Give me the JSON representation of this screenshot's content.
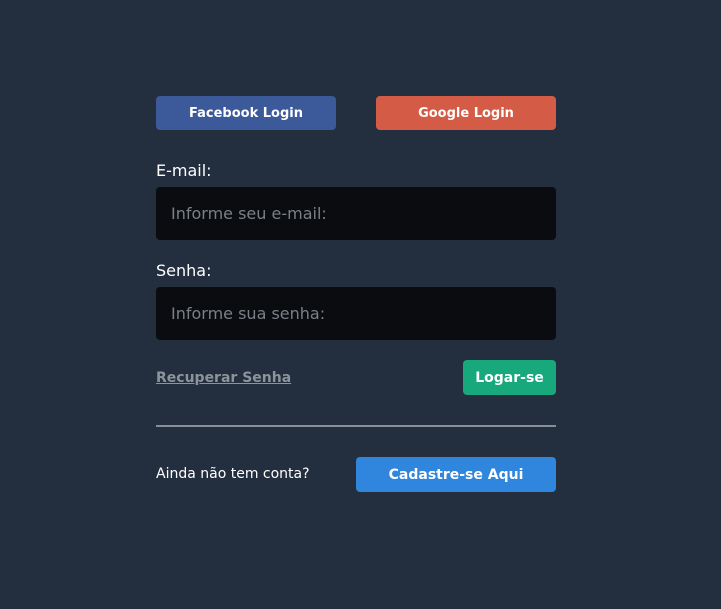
{
  "social": {
    "facebook_label": "Facebook Login",
    "google_label": "Google Login"
  },
  "form": {
    "email_label": "E-mail:",
    "email_placeholder": "Informe seu e-mail:",
    "email_value": "",
    "password_label": "Senha:",
    "password_placeholder": "Informe sua senha:",
    "password_value": "",
    "recover_link": "Recuperar Senha",
    "login_button": "Logar-se"
  },
  "signup": {
    "prompt": "Ainda não tem conta?",
    "button": "Cadastre-se Aqui"
  },
  "colors": {
    "background": "#232f3f",
    "facebook": "#3c5a99",
    "google": "#d45b45",
    "login": "#17a97b",
    "signup": "#2f86dc",
    "input_bg": "#0a0c10"
  }
}
